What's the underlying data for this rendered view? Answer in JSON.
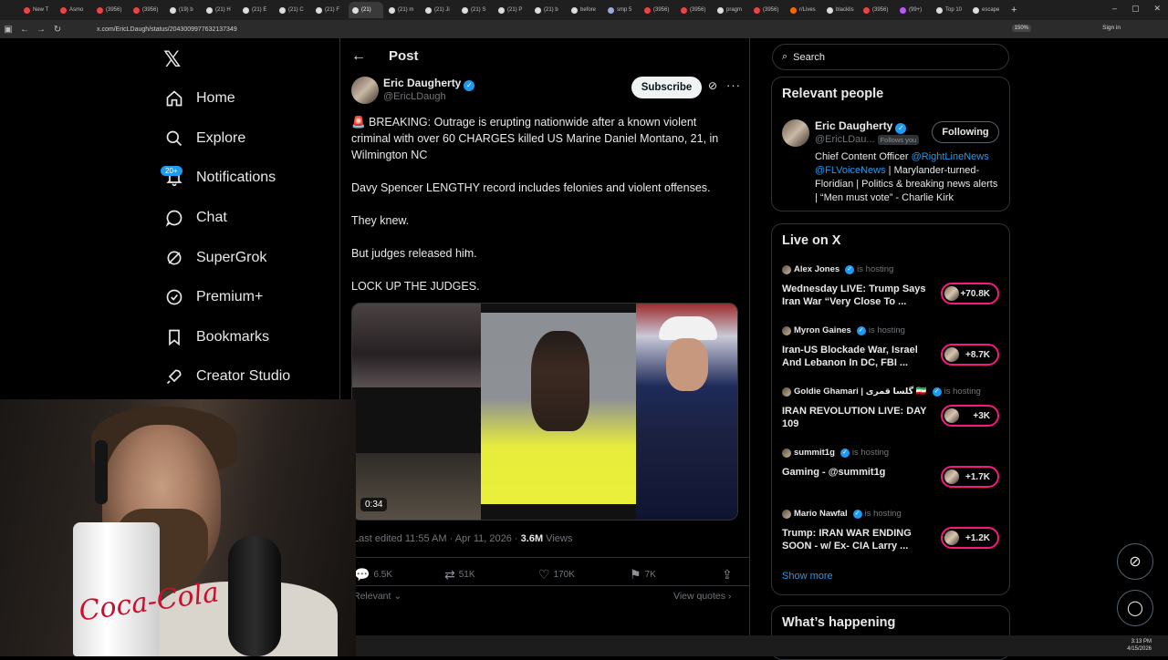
{
  "browser": {
    "tabs": [
      {
        "title": "New T",
        "color": "#e44"
      },
      {
        "title": "Asmo",
        "color": "#e44"
      },
      {
        "title": "(3956)",
        "color": "#e44"
      },
      {
        "title": "(3956)",
        "color": "#e44"
      },
      {
        "title": "(19) b",
        "color": "#ddd"
      },
      {
        "title": "(21) H",
        "color": "#ddd"
      },
      {
        "title": "(21) E",
        "color": "#ddd"
      },
      {
        "title": "(21) C",
        "color": "#ddd"
      },
      {
        "title": "(21) F",
        "color": "#ddd"
      },
      {
        "title": "(21)",
        "color": "#ddd",
        "active": true
      },
      {
        "title": "(21) m",
        "color": "#ddd"
      },
      {
        "title": "(21) Ji",
        "color": "#ddd"
      },
      {
        "title": "(21) S",
        "color": "#ddd"
      },
      {
        "title": "(21) P",
        "color": "#ddd"
      },
      {
        "title": "(21) b",
        "color": "#ddd"
      },
      {
        "title": "before",
        "color": "#ddd"
      },
      {
        "title": "smp 5",
        "color": "#9ad"
      },
      {
        "title": "(3956)",
        "color": "#e44"
      },
      {
        "title": "(3956)",
        "color": "#e44"
      },
      {
        "title": "pragm",
        "color": "#ddd"
      },
      {
        "title": "(3956)",
        "color": "#e44"
      },
      {
        "title": "r/Lives",
        "color": "#f60"
      },
      {
        "title": "blacklis",
        "color": "#ddd"
      },
      {
        "title": "(3956)",
        "color": "#e44"
      },
      {
        "title": "(99+)",
        "color": "#b5f"
      },
      {
        "title": "Top 10",
        "color": "#ddd"
      },
      {
        "title": "escape",
        "color": "#ddd"
      }
    ],
    "new_tab": "+",
    "url": "x.com/EricLDaugh/status/2043009977632137349",
    "zoom": "150%",
    "sign_in": "Sign in",
    "window_controls": [
      "–",
      "▢",
      "✕"
    ]
  },
  "nav": {
    "items": [
      {
        "label": "Home",
        "icon": "home-icon"
      },
      {
        "label": "Explore",
        "icon": "search-icon"
      },
      {
        "label": "Notifications",
        "icon": "bell-icon"
      },
      {
        "label": "Chat",
        "icon": "chat-icon"
      },
      {
        "label": "SuperGrok",
        "icon": "grok-icon"
      },
      {
        "label": "Premium+",
        "icon": "premium-icon"
      },
      {
        "label": "Bookmarks",
        "icon": "bookmark-icon"
      },
      {
        "label": "Creator Studio",
        "icon": "rocket-icon"
      }
    ],
    "notification_badge": "20+"
  },
  "post": {
    "header": "Post",
    "author_name": "Eric Daugherty",
    "author_handle": "@EricLDaugh",
    "subscribe_label": "Subscribe",
    "paragraphs": [
      "🚨 BREAKING: Outrage is erupting nationwide after a known violent criminal with over 60 CHARGES killed US Marine Daniel Montano, 21, in Wilmington NC",
      "Davy Spencer LENGTHY record includes felonies and violent offenses.",
      "They knew.",
      "But judges released him.",
      "LOCK UP THE JUDGES."
    ],
    "video_duration": "0:34",
    "meta_prefix": "Last edited 11:55 AM · Apr 11, 2026 · ",
    "views_count": "3.6M",
    "views_label": " Views",
    "actions": {
      "replies": "6.5K",
      "reposts": "51K",
      "likes": "170K",
      "bookmarks": "7K"
    },
    "sort_label": "Relevant",
    "view_quotes": "View quotes"
  },
  "sidebar": {
    "search_placeholder": "Search",
    "relevant_title": "Relevant people",
    "relevant_person": {
      "name": "Eric Daugherty",
      "handle": "@EricLDau...",
      "follows_you": "Follows you",
      "button": "Following",
      "bio_line1_pre": "Chief Content Officer ",
      "bio_link1": "@RightLineNews",
      "bio_link2": "@FLVoiceNews",
      "bio_rest": " | Marylander-turned-Floridian | Politics & breaking news alerts | “Men must vote” - Charlie Kirk"
    },
    "live_title": "Live on X",
    "hosting_label": "is hosting",
    "live": [
      {
        "host": "Alex Jones",
        "title": "Wednesday LIVE: Trump Says Iran War “Very Close To ...",
        "count": "+70.8K"
      },
      {
        "host": "Myron Gaines",
        "title": "Iran-US Blockade War, Israel And Lebanon In DC, FBI ...",
        "count": "+8.7K"
      },
      {
        "host": "Goldie Ghamari | گلسا قمری 🇮🇷",
        "title": "IRAN REVOLUTION LIVE: DAY 109",
        "count": "+3K"
      },
      {
        "host": "summit1g",
        "title": "Gaming - @summit1g",
        "count": "+1.7K"
      },
      {
        "host": "Mario Nawfal",
        "title": "Trump: IRAN WAR ENDING SOON - w/ Ex- CIA Larry ...",
        "count": "+1.2K"
      }
    ],
    "show_more": "Show more",
    "whats_happening": "What’s happening"
  },
  "webcam": {
    "cup_text": "Coca-Cola"
  },
  "taskbar": {
    "time": "3:13 PM",
    "date": "4/15/2026"
  }
}
